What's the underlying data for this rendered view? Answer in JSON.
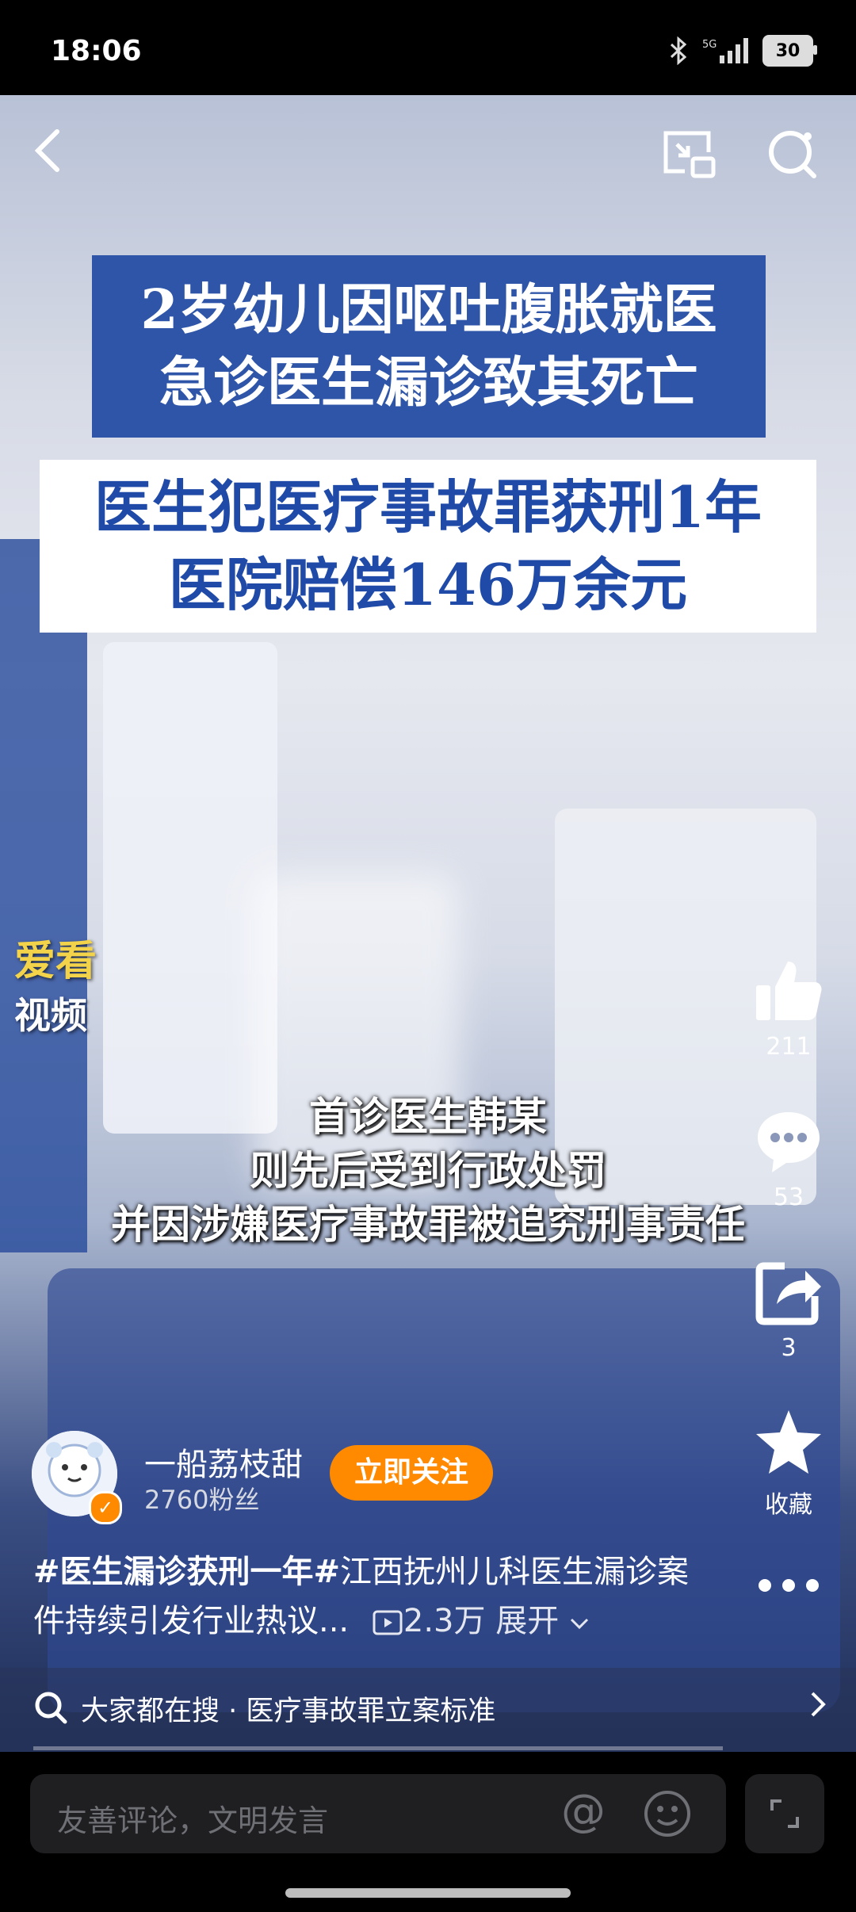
{
  "status": {
    "time": "18:06",
    "network": "5G",
    "battery": "30"
  },
  "video": {
    "headline1": [
      "2岁幼儿因呕吐腹胀就医",
      "急诊医生漏诊致其死亡"
    ],
    "headline2": [
      "医生犯医疗事故罪获刑1年",
      "医院赔偿146万余元"
    ],
    "watermark_top": "爱看",
    "watermark_bottom": "视频",
    "subtitle": [
      "首诊医生韩某",
      "则先后受到行政处罚",
      "并因涉嫌医疗事故罪被追究刑事责任"
    ]
  },
  "actions": {
    "like_count": "211",
    "comment_count": "53",
    "share_count": "3",
    "favorite_label": "收藏"
  },
  "author": {
    "name": "一船荔枝甜",
    "fans": "2760粉丝",
    "follow_label": "立即关注"
  },
  "description": {
    "tag1": "#医生漏诊获刑一年#",
    "text": "江西抚州儿科医生漏诊案件持续引发行业热议...",
    "views": "2.3万",
    "expand": "展开"
  },
  "search_suggestion": "大家都在搜 · 医疗事故罪立案标准",
  "comment_placeholder": "友善评论，文明发言",
  "colors": {
    "accent": "#ff8a00",
    "headline_blue": "#2e55a8"
  },
  "progress": 0.0
}
